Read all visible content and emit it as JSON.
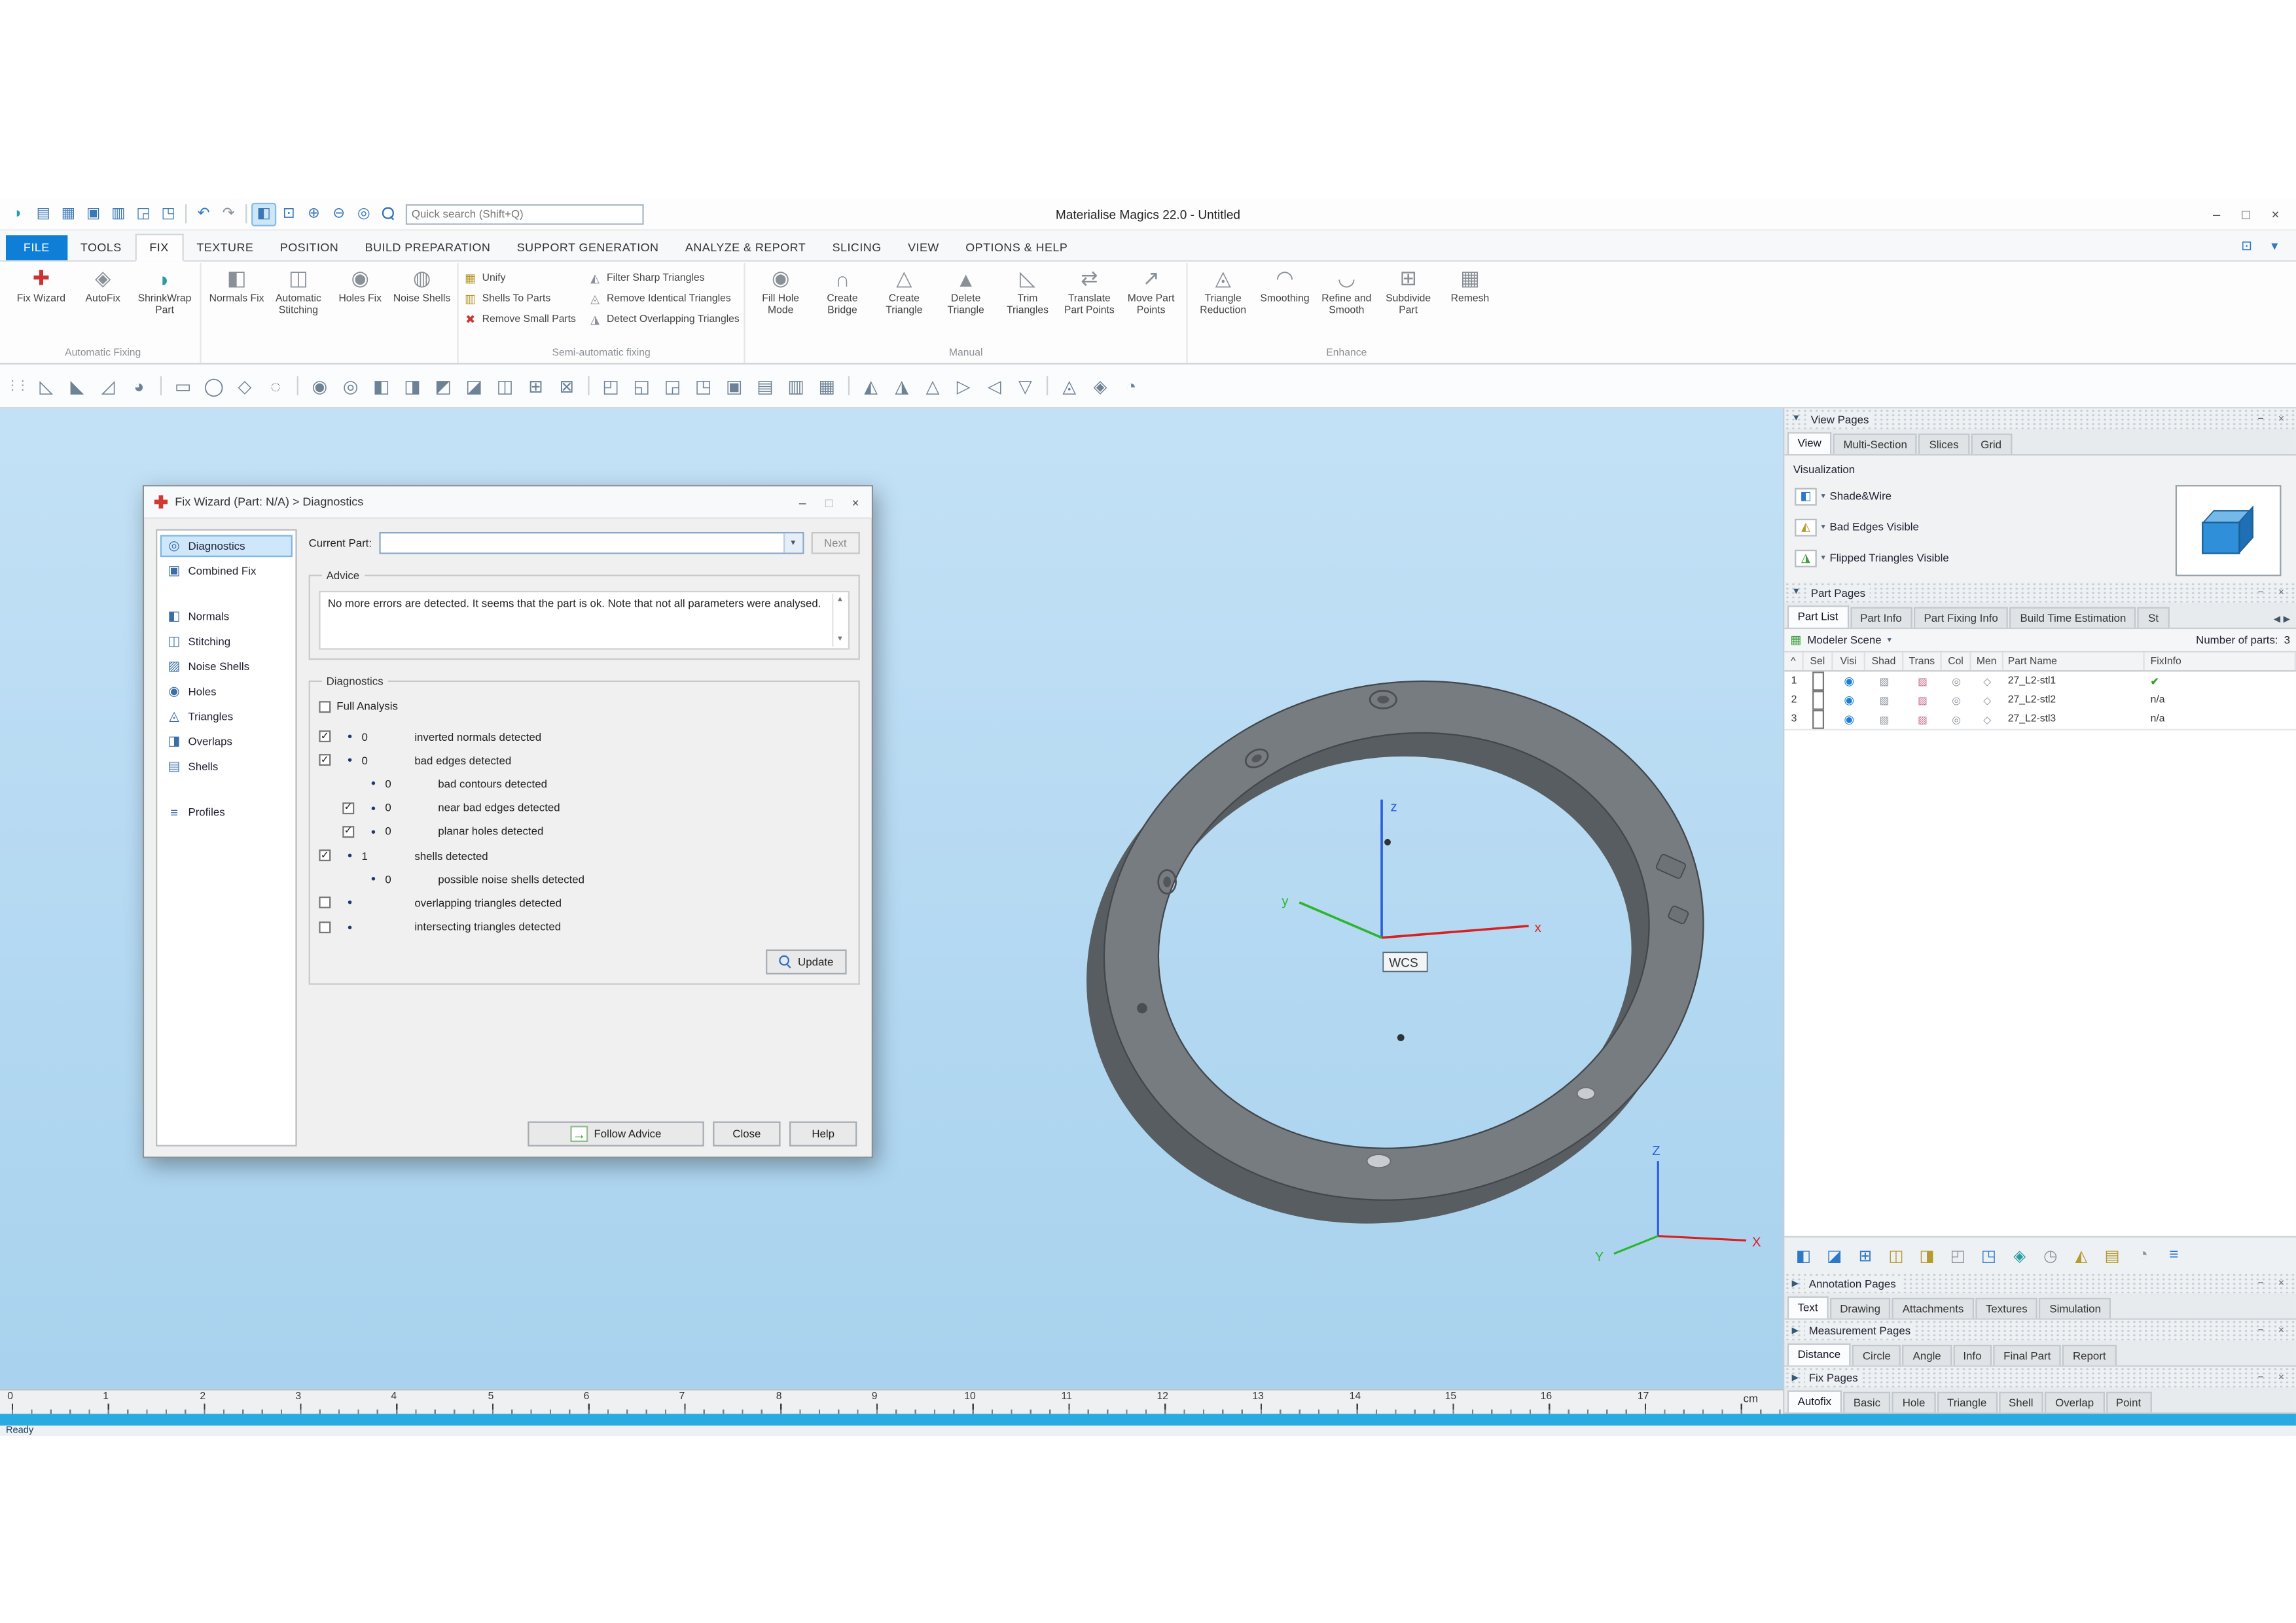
{
  "colors": {
    "accent_blue": "#0e7ed6",
    "status_bar_blue": "#29abe2",
    "viewport_top": "#c3e1f6",
    "viewport_bottom": "#a8d2ee",
    "fix_ok_green": "#2f9e2f",
    "axis_x_red": "#d92020",
    "axis_y_green": "#2db52d",
    "axis_z_blue": "#2b5fd9"
  },
  "glyphs": {
    "dropdown": "▾",
    "bullet": "•",
    "scroll_up": "▲",
    "scroll_down": "▼",
    "scroll_left": "◀",
    "scroll_right": "▶",
    "pin": "−",
    "close": "×",
    "sort": "^"
  },
  "titlebar": {
    "title": "Materialise Magics 22.0 - Untitled",
    "search_placeholder": "Quick search (Shift+Q)",
    "minimize_glyph": "–",
    "maximize_glyph": "□",
    "close_glyph": "×",
    "icons": [
      {
        "name": "app-logo",
        "glyph": "◗"
      },
      {
        "name": "new-scene",
        "glyph": "▤"
      },
      {
        "name": "open-project",
        "glyph": "▦"
      },
      {
        "name": "save-project",
        "glyph": "▣"
      },
      {
        "name": "save-all",
        "glyph": "▥"
      },
      {
        "name": "import-part",
        "glyph": "◲"
      },
      {
        "name": "export-part",
        "glyph": "◳"
      },
      {
        "name": "undo",
        "glyph": "↶"
      },
      {
        "name": "redo",
        "glyph": "↷"
      },
      {
        "name": "select-cube",
        "glyph": "◧"
      },
      {
        "name": "zoom-rect",
        "glyph": "⊡"
      },
      {
        "name": "zoom-in",
        "glyph": "⊕"
      },
      {
        "name": "zoom-out",
        "glyph": "⊖"
      },
      {
        "name": "zoom-fit",
        "glyph": "◎"
      }
    ]
  },
  "menubar": {
    "layout_glyph": "⊡",
    "more_glyph": "▾",
    "tabs": [
      {
        "label": "FILE"
      },
      {
        "label": "TOOLS"
      },
      {
        "label": "FIX"
      },
      {
        "label": "TEXTURE"
      },
      {
        "label": "POSITION"
      },
      {
        "label": "BUILD PREPARATION"
      },
      {
        "label": "SUPPORT GENERATION"
      },
      {
        "label": "ANALYZE & REPORT"
      },
      {
        "label": "SLICING"
      },
      {
        "label": "VIEW"
      },
      {
        "label": "OPTIONS & HELP"
      }
    ]
  },
  "ribbon": {
    "groups": [
      {
        "label": "Automatic Fixing",
        "buttons": [
          {
            "label": "Fix Wizard",
            "glyph": "✚"
          },
          {
            "label": "AutoFix",
            "glyph": "◈"
          },
          {
            "label": "ShrinkWrap Part",
            "glyph": "◗"
          }
        ]
      },
      {
        "label": "",
        "buttons": [
          {
            "label": "Normals Fix",
            "glyph": "◧"
          },
          {
            "label": "Automatic Stitching",
            "glyph": "◫"
          },
          {
            "label": "Holes Fix",
            "glyph": "◉"
          },
          {
            "label": "Noise Shells",
            "glyph": "◍"
          }
        ]
      },
      {
        "label": "Semi-automatic fixing",
        "stack1": [
          {
            "label": "Unify",
            "glyph": "▦"
          },
          {
            "label": "Shells To Parts",
            "glyph": "▥"
          },
          {
            "label": "Remove Small Parts",
            "glyph": "✖"
          }
        ],
        "stack2": [
          {
            "label": "Filter Sharp Triangles",
            "glyph": "◭"
          },
          {
            "label": "Remove Identical Triangles",
            "glyph": "◬"
          },
          {
            "label": "Detect Overlapping Triangles",
            "glyph": "◮"
          }
        ]
      },
      {
        "label": "Manual",
        "buttons": [
          {
            "label": "Fill Hole Mode",
            "glyph": "◉"
          },
          {
            "label": "Create Bridge",
            "glyph": "∩"
          },
          {
            "label": "Create Triangle",
            "glyph": "△"
          },
          {
            "label": "Delete Triangle",
            "glyph": "▲"
          },
          {
            "label": "Trim Triangles",
            "glyph": "◺"
          },
          {
            "label": "Translate Part Points",
            "glyph": "⇄"
          },
          {
            "label": "Move Part Points",
            "glyph": "↗"
          }
        ]
      },
      {
        "label": "Enhance",
        "buttons": [
          {
            "label": "Triangle Reduction",
            "glyph": "◬"
          },
          {
            "label": "Smoothing",
            "glyph": "◠"
          },
          {
            "label": "Refine and Smooth",
            "glyph": "◡"
          },
          {
            "label": "Subdivide Part",
            "glyph": "⊞"
          },
          {
            "label": "Remesh",
            "glyph": "▦"
          }
        ]
      }
    ]
  },
  "toolbar2": {
    "icons": [
      {
        "name": "mark-triangle",
        "glyph": "◺"
      },
      {
        "name": "mark-plane",
        "glyph": "◣"
      },
      {
        "name": "mark-surface",
        "glyph": "◿"
      },
      {
        "name": "mark-shell",
        "glyph": "◕"
      },
      {
        "name": "select-rectangle",
        "glyph": "▭"
      },
      {
        "name": "select-ellipse",
        "glyph": "◯"
      },
      {
        "name": "select-polygon",
        "glyph": "◇"
      },
      {
        "name": "select-freeform",
        "glyph": "◌"
      },
      {
        "name": "gear-tool",
        "glyph": "◉"
      },
      {
        "name": "ring-tool",
        "glyph": "◎"
      },
      {
        "name": "cube-left",
        "glyph": "◧"
      },
      {
        "name": "cube-right",
        "glyph": "◨"
      },
      {
        "name": "cube-top",
        "glyph": "◩"
      },
      {
        "name": "cube-bottom",
        "glyph": "◪"
      },
      {
        "name": "cube-split",
        "glyph": "◫"
      },
      {
        "name": "grid-add",
        "glyph": "⊞"
      },
      {
        "name": "grid-cut",
        "glyph": "⊠"
      },
      {
        "name": "view-iso1",
        "glyph": "◰"
      },
      {
        "name": "view-iso2",
        "glyph": "◱"
      },
      {
        "name": "view-iso3",
        "glyph": "◲"
      },
      {
        "name": "view-iso4",
        "glyph": "◳"
      },
      {
        "name": "shaded-view",
        "glyph": "▣"
      },
      {
        "name": "wireframe-view",
        "glyph": "▤"
      },
      {
        "name": "hatch-view",
        "glyph": "▥"
      },
      {
        "name": "mesh-view",
        "glyph": "▦"
      },
      {
        "name": "measure-a",
        "glyph": "◭"
      },
      {
        "name": "measure-b",
        "glyph": "◮"
      },
      {
        "name": "triangle-up",
        "glyph": "△"
      },
      {
        "name": "triangle-right",
        "glyph": "▷"
      },
      {
        "name": "triangle-left",
        "glyph": "◁"
      },
      {
        "name": "triangle-down",
        "glyph": "▽"
      },
      {
        "name": "reduce",
        "glyph": "◬"
      },
      {
        "name": "diamond-tool",
        "glyph": "◈"
      },
      {
        "name": "orient-tool",
        "glyph": "◔"
      }
    ]
  },
  "viewport": {
    "wcs_label": "WCS",
    "axes": {
      "x": "x",
      "y": "y",
      "z": "z"
    },
    "mini_axes": {
      "x": "X",
      "y": "Y",
      "z": "Z"
    }
  },
  "ruler": {
    "unit": "cm",
    "numbers": [
      "0",
      "1",
      "2",
      "3",
      "4",
      "5",
      "6",
      "7",
      "8",
      "9",
      "10",
      "11",
      "12",
      "13",
      "14",
      "15",
      "16",
      "17"
    ]
  },
  "status": {
    "ready": "Ready"
  },
  "right_panel": {
    "view_pages": {
      "title": "View Pages",
      "tri": "▼",
      "tabs": [
        {
          "label": "View"
        },
        {
          "label": "Multi-Section"
        },
        {
          "label": "Slices"
        },
        {
          "label": "Grid"
        }
      ],
      "visualization_title": "Visualization",
      "options": [
        {
          "label": "Shade&Wire",
          "glyph": "◧"
        },
        {
          "label": "Bad Edges Visible",
          "glyph": "◭"
        },
        {
          "label": "Flipped Triangles Visible",
          "glyph": "◮"
        }
      ]
    },
    "part_pages": {
      "title": "Part Pages",
      "tri": "▼",
      "tabs": [
        {
          "label": "Part List"
        },
        {
          "label": "Part Info"
        },
        {
          "label": "Part Fixing Info"
        },
        {
          "label": "Build Time Estimation"
        },
        {
          "label": "St"
        }
      ],
      "scene_glyph": "▦",
      "scene_name": "Modeler Scene",
      "parts_count_label": "Number of parts:",
      "parts_count": "3",
      "columns": {
        "sel": "Sel",
        "visi": "Visi",
        "shad": "Shad",
        "trans": "Trans",
        "col": "Col",
        "men": "Men",
        "name": "Part Name",
        "fixinfo": "FixInfo"
      },
      "row_icons": {
        "eye": "◉",
        "shad": "▧",
        "trans": "▨",
        "col": "◎",
        "men": "◇"
      },
      "rows": [
        {
          "num": "1",
          "name": "27_L2-stl1",
          "fixinfo": "✔"
        },
        {
          "num": "2",
          "name": "27_L2-stl2",
          "fixinfo": "n/a"
        },
        {
          "num": "3",
          "name": "27_L2-stl3",
          "fixinfo": "n/a"
        }
      ],
      "tools": [
        {
          "name": "fix-selected",
          "glyph": "◧"
        },
        {
          "name": "shade-part",
          "glyph": "◪"
        },
        {
          "name": "add-platform",
          "glyph": "⊞"
        },
        {
          "name": "merge-parts",
          "glyph": "◫"
        },
        {
          "name": "compare-parts",
          "glyph": "◨"
        },
        {
          "name": "frame-part",
          "glyph": "◰"
        },
        {
          "name": "export-scene",
          "glyph": "◳"
        },
        {
          "name": "highlight-part",
          "glyph": "◈"
        },
        {
          "name": "rotate-part",
          "glyph": "◷"
        },
        {
          "name": "orient-part",
          "glyph": "◭"
        },
        {
          "name": "part-list",
          "glyph": "▤"
        },
        {
          "name": "render-part",
          "glyph": "◔"
        },
        {
          "name": "sort-parts",
          "glyph": "≡"
        }
      ]
    },
    "annotation_pages": {
      "title": "Annotation Pages",
      "tri": "▶",
      "tabs": [
        {
          "label": "Text"
        },
        {
          "label": "Drawing"
        },
        {
          "label": "Attachments"
        },
        {
          "label": "Textures"
        },
        {
          "label": "Simulation"
        }
      ]
    },
    "measurement_pages": {
      "title": "Measurement Pages",
      "tri": "▶",
      "tabs": [
        {
          "label": "Distance"
        },
        {
          "label": "Circle"
        },
        {
          "label": "Angle"
        },
        {
          "label": "Info"
        },
        {
          "label": "Final Part"
        },
        {
          "label": "Report"
        }
      ]
    },
    "fix_pages": {
      "title": "Fix Pages",
      "tri": "▶",
      "tabs": [
        {
          "label": "Autofix"
        },
        {
          "label": "Basic"
        },
        {
          "label": "Hole"
        },
        {
          "label": "Triangle"
        },
        {
          "label": "Shell"
        },
        {
          "label": "Overlap"
        },
        {
          "label": "Point"
        }
      ]
    }
  },
  "fix_wizard": {
    "title": "Fix Wizard (Part: N/A) > Diagnostics",
    "minimize_glyph": "–",
    "maximize_glyph": "□",
    "close_glyph": "×",
    "sidebar": [
      {
        "label": "Diagnostics",
        "glyph": "◎"
      },
      {
        "label": "Combined Fix",
        "glyph": "▣"
      },
      {
        "label": "Normals",
        "glyph": "◧"
      },
      {
        "label": "Stitching",
        "glyph": "◫"
      },
      {
        "label": "Noise Shells",
        "glyph": "▨"
      },
      {
        "label": "Holes",
        "glyph": "◉"
      },
      {
        "label": "Triangles",
        "glyph": "◬"
      },
      {
        "label": "Overlaps",
        "glyph": "◨"
      },
      {
        "label": "Shells",
        "glyph": "▤"
      },
      {
        "label": "Profiles",
        "glyph": "≡"
      }
    ],
    "current_part_label": "Current Part:",
    "current_part_value": "",
    "next_button": "Next",
    "advice_title": "Advice",
    "advice_text": "No more errors are detected. It seems that the part is ok. Note that not all parameters were analysed.",
    "diagnostics_title": "Diagnostics",
    "full_analysis_label": "Full Analysis",
    "rows": [
      {
        "mark": "✓",
        "count": "0",
        "label": "inverted normals detected"
      },
      {
        "mark": "✓",
        "count": "0",
        "label": "bad edges detected"
      },
      {
        "count": "0",
        "label": "bad contours detected"
      },
      {
        "mark": "✓",
        "count": "0",
        "label": "near bad edges detected"
      },
      {
        "mark": "✓",
        "count": "0",
        "label": "planar holes detected"
      },
      {
        "mark": "✓",
        "count": "1",
        "label": "shells detected"
      },
      {
        "count": "0",
        "label": "possible noise shells detected"
      },
      {
        "mark": "",
        "count": "",
        "label": "overlapping triangles detected"
      },
      {
        "mark": "",
        "count": "",
        "label": "intersecting triangles detected"
      }
    ],
    "update_button": "Update",
    "follow_advice_button": "Follow Advice",
    "follow_advice_glyph": "→",
    "close_button": "Close",
    "help_button": "Help"
  }
}
